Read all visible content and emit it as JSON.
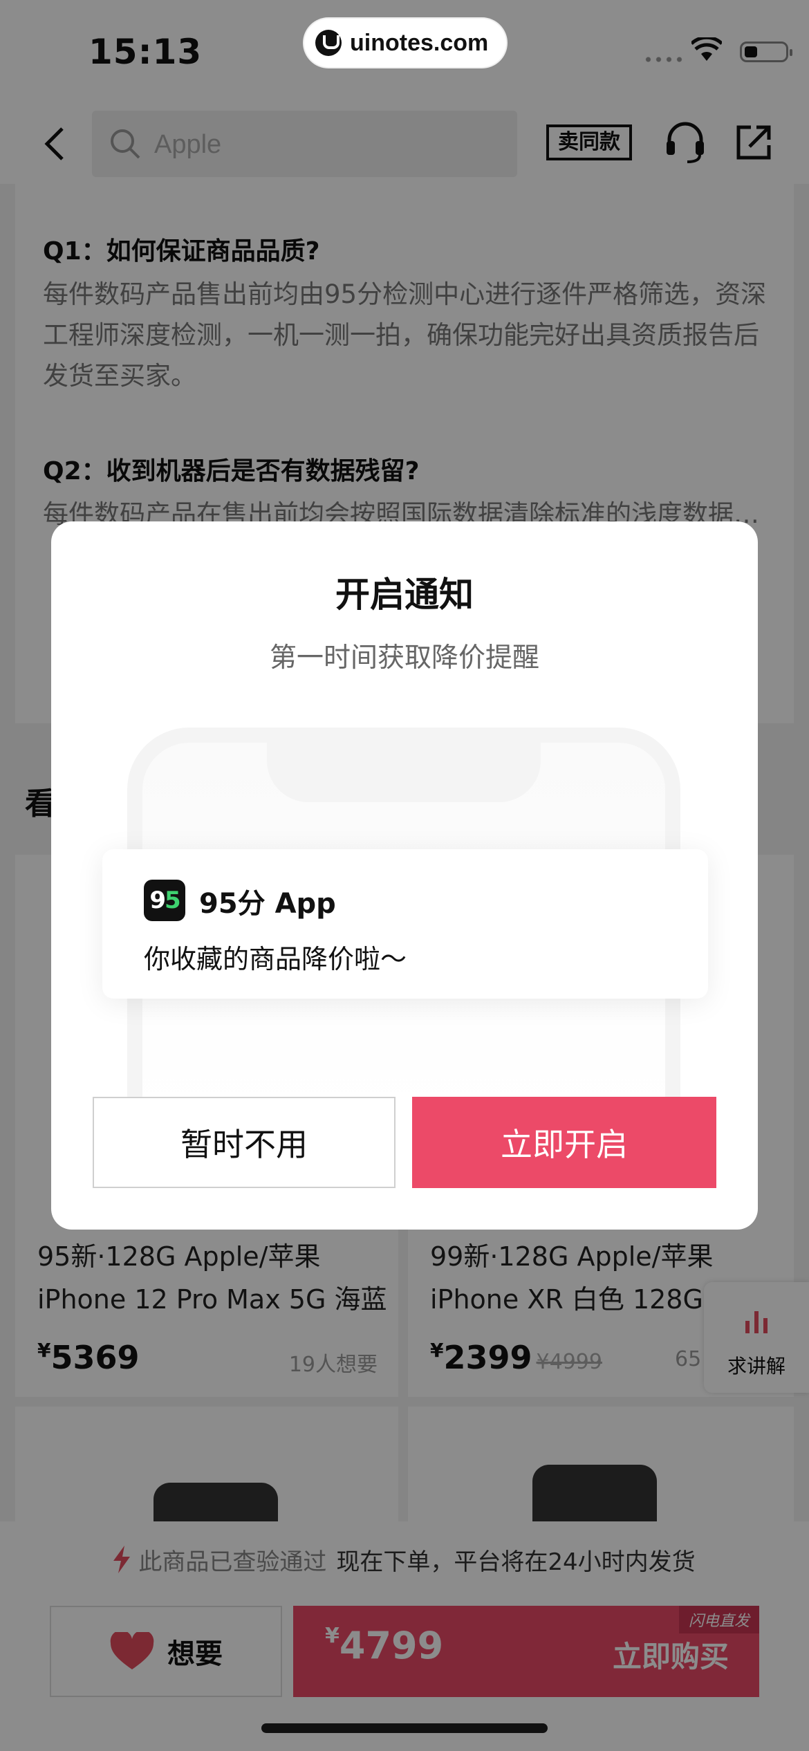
{
  "status_bar": {
    "time": "15:13",
    "watermark": "uinotes.com"
  },
  "search": {
    "placeholder": "Apple"
  },
  "header": {
    "same_style_label": "卖同款"
  },
  "faq": {
    "items": [
      {
        "q": "Q1：如何保证商品品质?",
        "a": "每件数码产品售出前均由95分检测中心进行逐件严格筛选，资深工程师深度检测，一机一测一拍，确保功能完好出具资质报告后发货至买家。"
      },
      {
        "q": "Q2：收到机器后是否有数据残留?",
        "a": "每件数码产品在售出前均会按照国际数据清除标准的浅度数据…"
      }
    ]
  },
  "section": {
    "title": "看"
  },
  "products": [
    {
      "title_line1": "95新·128G  Apple/苹果",
      "title_line2": "iPhone 12 Pro Max 5G 海蓝",
      "price_symbol": "¥",
      "price": "5369",
      "original_price": "",
      "wants": "19人想要"
    },
    {
      "title_line1": "99新·128G  Apple/苹果",
      "title_line2": "iPhone XR 白色 128G 其",
      "price_symbol": "¥",
      "price": "2399",
      "original_price": "¥4999",
      "wants": "65"
    }
  ],
  "float_button": {
    "label": "求讲解"
  },
  "notice": {
    "prefix": "此商品已查验通过",
    "main": "现在下单，平台将在24小时内发货"
  },
  "bottom_bar": {
    "want_label": "想要",
    "price_symbol": "¥",
    "price": "4799",
    "buy_label": "立即购买",
    "badge": "闪电直发"
  },
  "modal": {
    "title": "开启通知",
    "subtitle": "第一时间获取降价提醒",
    "app_icon_text_a": "9",
    "app_icon_text_b": "5",
    "app_name": "95分 App",
    "notification_body": "你收藏的商品降价啦～",
    "later_label": "暂时不用",
    "enable_label": "立即开启"
  },
  "colors": {
    "accent": "#ec4a68",
    "overlay": "rgba(0,0,0,0.45)"
  }
}
